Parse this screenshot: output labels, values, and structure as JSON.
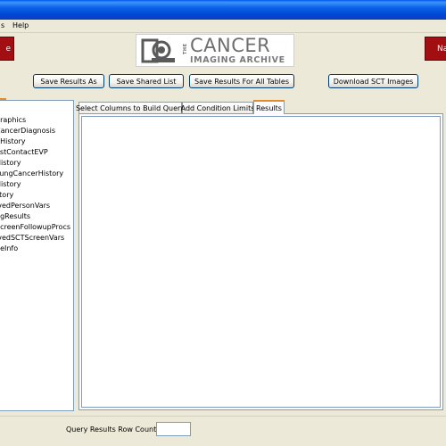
{
  "window": {
    "title": ""
  },
  "menubar": {
    "items": [
      "s",
      "Help"
    ]
  },
  "header": {
    "left_button_label": "e",
    "right_button_label": "Na",
    "logo": {
      "the": "THE",
      "cancer": "CANCER",
      "sub": "IMAGING ARCHIVE"
    }
  },
  "toolbar": {
    "save_results_as": "Save Results As",
    "save_shared_list": "Save Shared List",
    "save_results_all_tables": "Save Results For All Tables",
    "download_sct_images": "Download SCT Images"
  },
  "tree": {
    "items": [
      "graphics",
      "CancerDiagnosis",
      "gHistory",
      "astContactEVP",
      "History",
      "LungCancerHistory",
      "History",
      "story",
      "ivedPersonVars",
      "ngResults",
      "ScreenFollowupProcs",
      "ivedSCTScreenVars",
      "geInfo"
    ]
  },
  "tabs": {
    "select_columns": "Select Columns to Build Query",
    "add_condition_limits": "Add Condition Limits",
    "results": "Results"
  },
  "footer": {
    "row_count_label": "Query Results Row Count",
    "row_count_value": ""
  },
  "colors": {
    "accent_tab": "#e68b2c",
    "brand_red": "#a10f12",
    "titlebar_blue": "#0a61e5"
  }
}
